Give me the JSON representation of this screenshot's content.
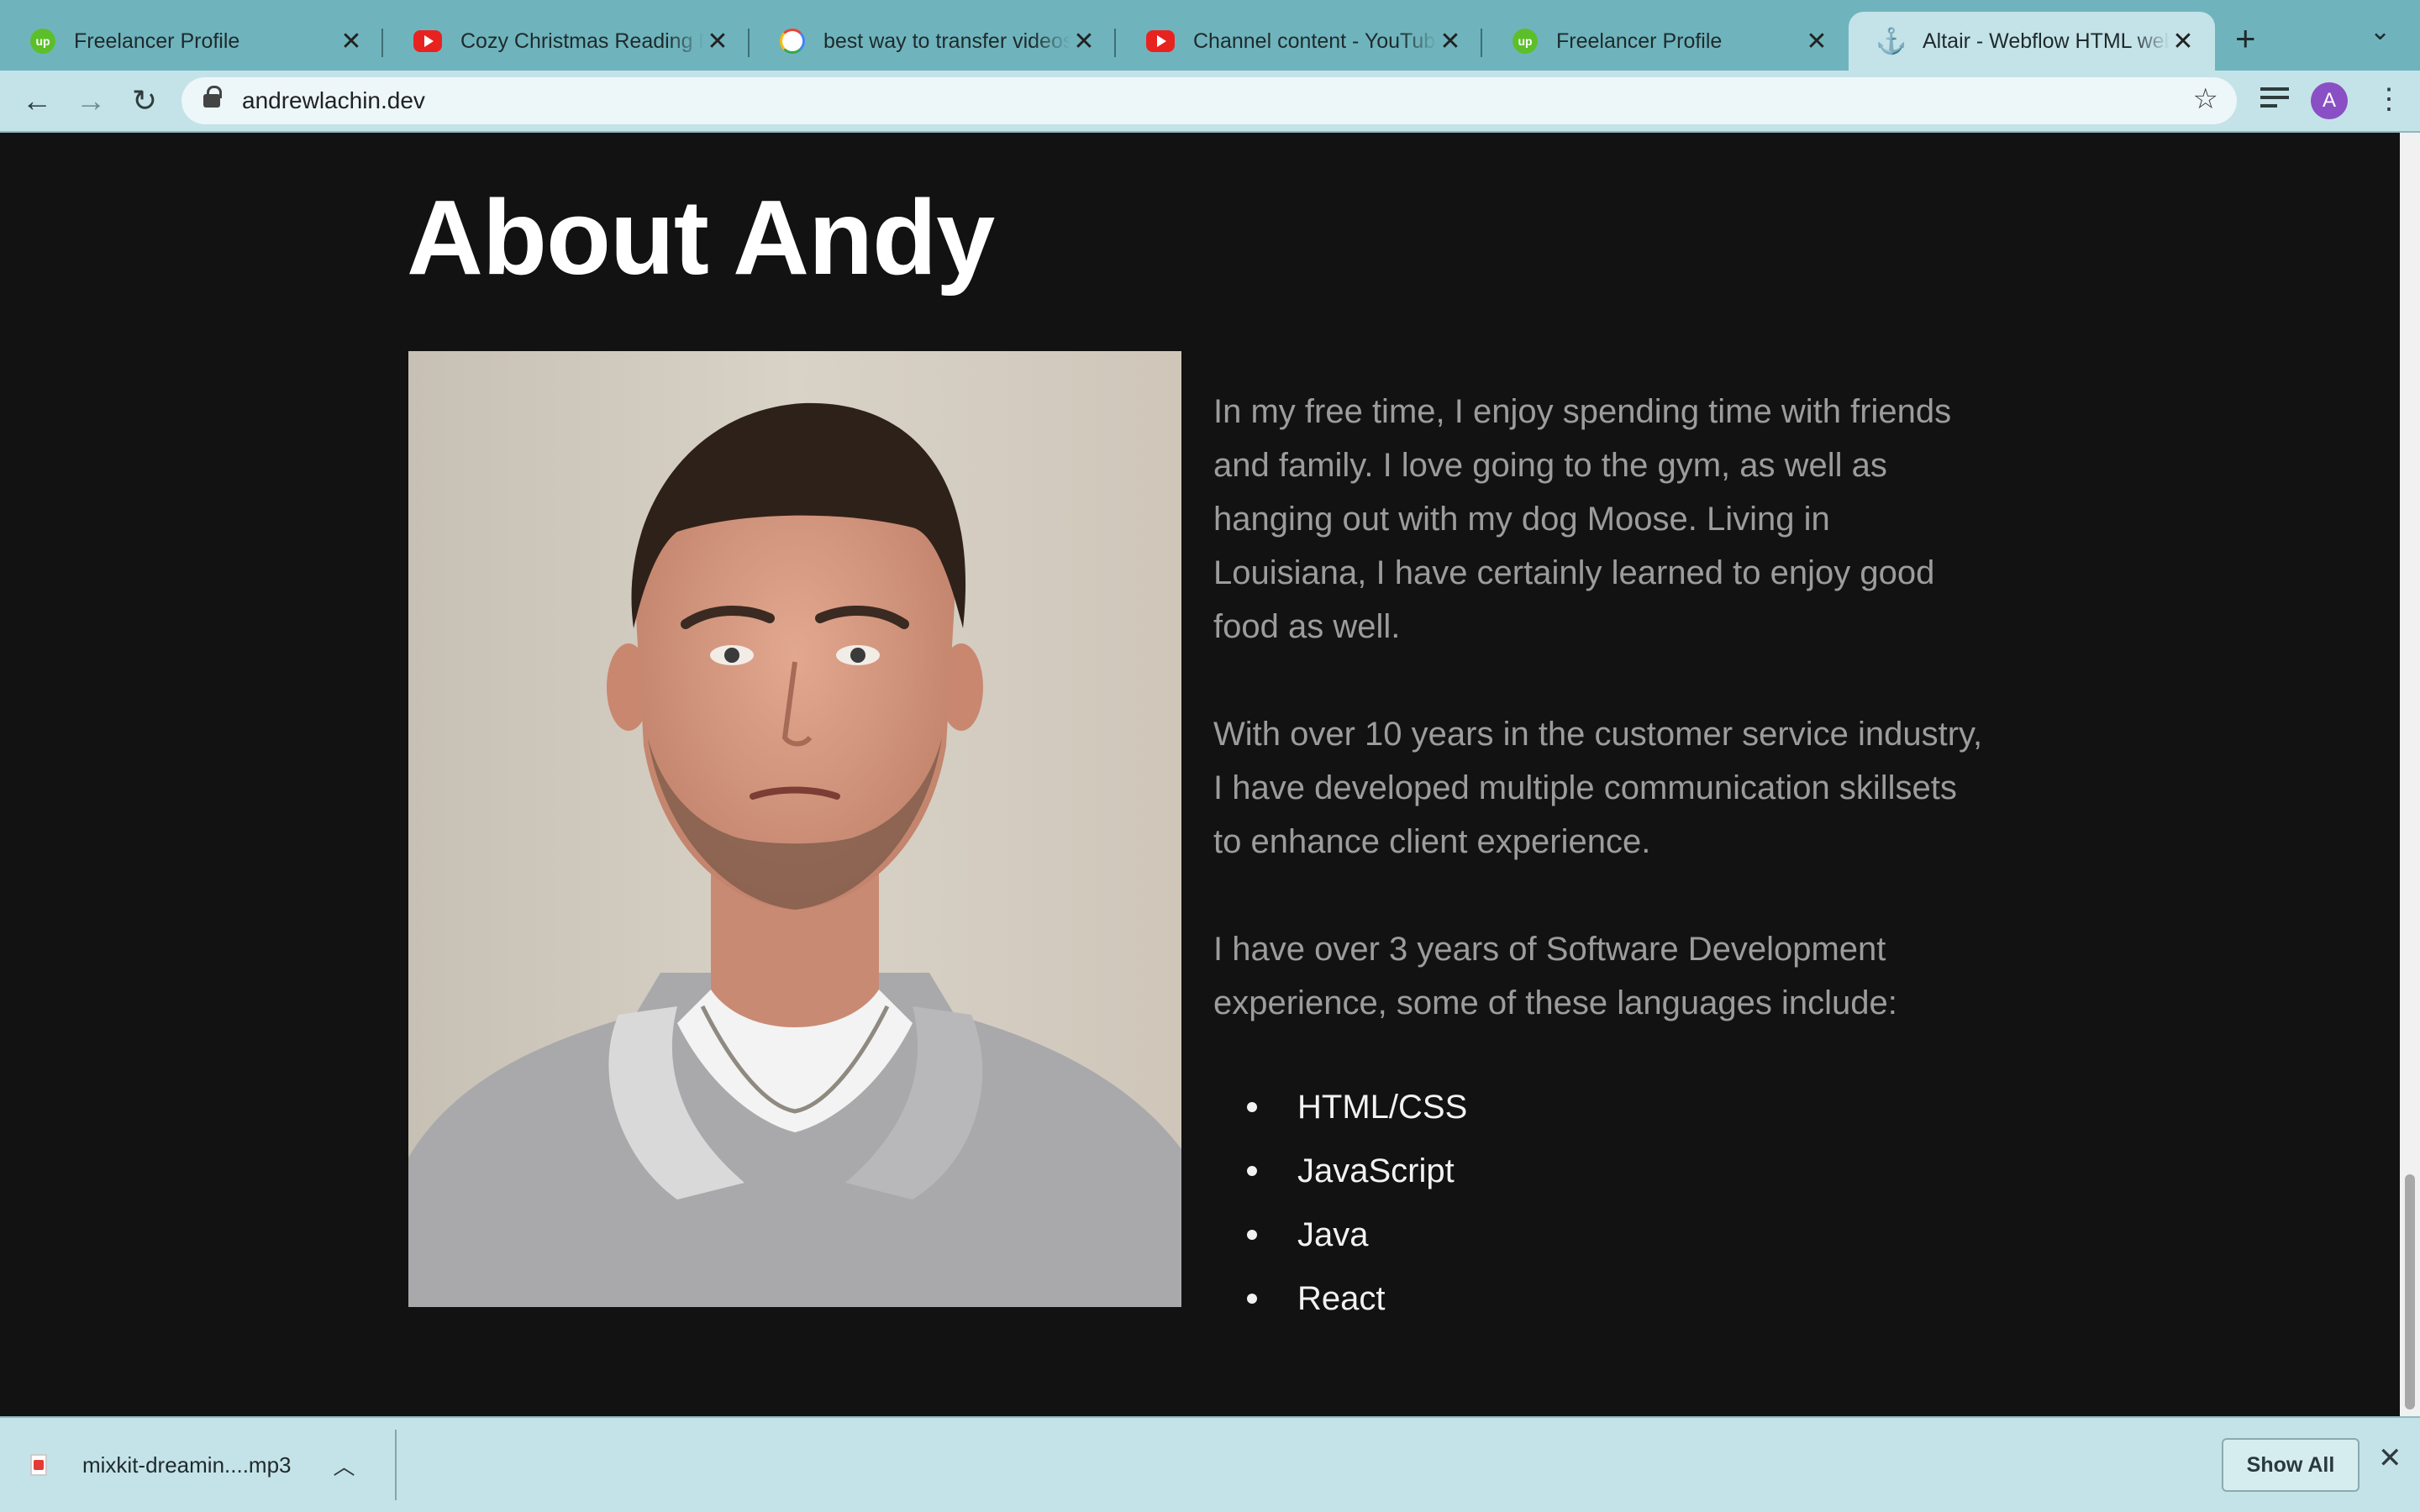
{
  "tabs": [
    {
      "title": "Freelancer Profile",
      "icon": "upwork-icon",
      "active": false
    },
    {
      "title": "Cozy Christmas Reading Nook",
      "icon": "youtube-icon",
      "active": false
    },
    {
      "title": "best way to transfer videos",
      "icon": "google-icon",
      "active": false
    },
    {
      "title": "Channel content - YouTube",
      "icon": "youtube-icon",
      "active": false
    },
    {
      "title": "Freelancer Profile",
      "icon": "upwork-icon",
      "active": false
    },
    {
      "title": "Altair - Webflow HTML website",
      "icon": "anchor-icon",
      "active": true
    }
  ],
  "toolbar": {
    "url": "andrewlachin.dev",
    "avatar_letter": "A",
    "new_tab_glyph": "+",
    "close_glyph": "✕"
  },
  "page": {
    "heading": "About Andy",
    "paragraphs": [
      "In my free time, I enjoy spending time with friends and family. I love going to the gym, as well as hanging out with my dog Moose. Living in Louisiana, I have certainly learned to enjoy good food as well.",
      "With over 10 years in the customer service industry, I have developed multiple communication skillsets to enhance client experience.",
      "I have over 3 years of Software Development experience, some of these languages include:"
    ],
    "languages": [
      "HTML/CSS",
      "JavaScript",
      "Java",
      "React"
    ]
  },
  "downloads": {
    "file_name": "mixkit-dreamin....mp3",
    "show_all_label": "Show All"
  },
  "colors": {
    "tabstrip": "#6fb4bd",
    "toolbar": "#c4e3e8",
    "page_background": "#121212",
    "body_text": "#9c9c9c",
    "heading_text": "#ffffff"
  }
}
